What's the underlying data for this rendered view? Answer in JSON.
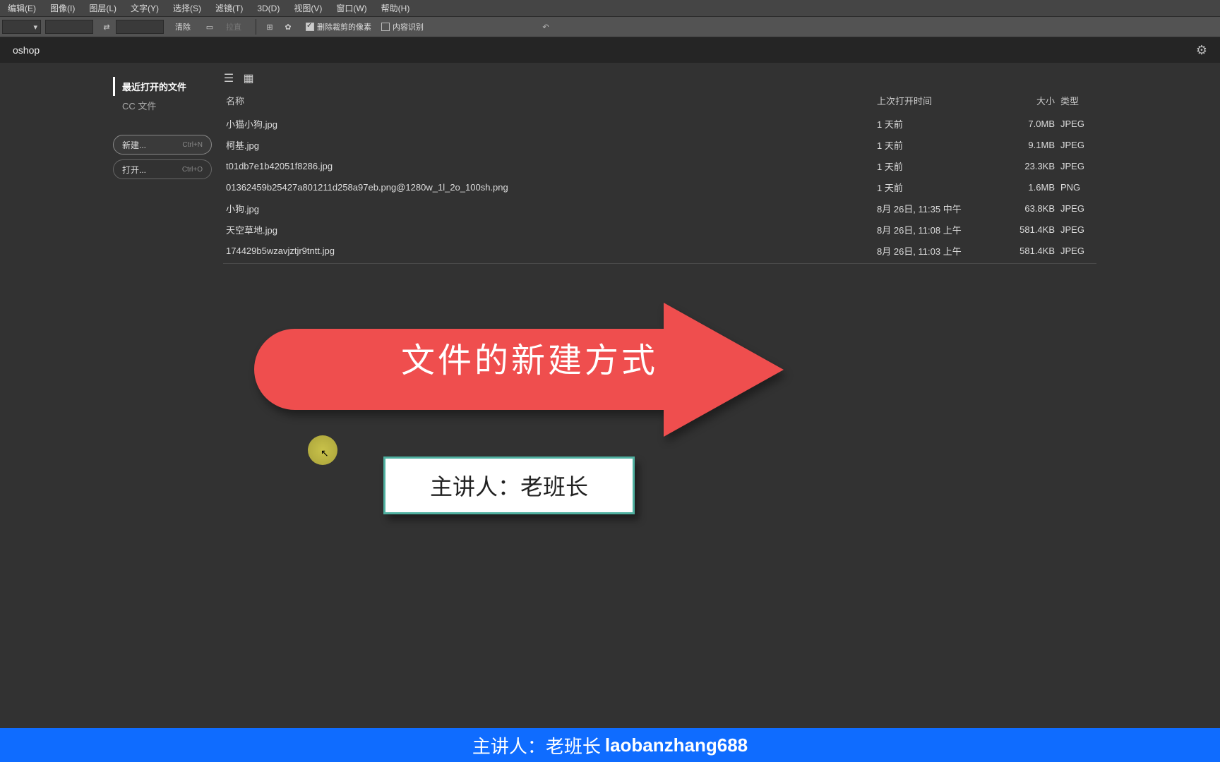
{
  "menubar": [
    "编辑(E)",
    "图像(I)",
    "图层(L)",
    "文字(Y)",
    "选择(S)",
    "滤镜(T)",
    "3D(D)",
    "视图(V)",
    "窗口(W)",
    "帮助(H)"
  ],
  "toolbar": {
    "clear": "清除",
    "straighten": "拉直",
    "opt1": "删除裁剪的像素",
    "opt2": "内容识别"
  },
  "appname": "oshop",
  "sidebar": {
    "recent": "最近打开的文件",
    "ccfiles": "CC 文件",
    "newbtn": "新建...",
    "newshort": "Ctrl+N",
    "openbtn": "打开...",
    "openshort": "Ctrl+O"
  },
  "cols": {
    "name": "名称",
    "opened": "上次打开时间",
    "size": "大小",
    "type": "类型"
  },
  "rows": [
    {
      "name": "小猫小狗.jpg",
      "opened": "1 天前",
      "size": "7.0MB",
      "type": "JPEG"
    },
    {
      "name": "柯基.jpg",
      "opened": "1 天前",
      "size": "9.1MB",
      "type": "JPEG"
    },
    {
      "name": "t01db7e1b42051f8286.jpg",
      "opened": "1 天前",
      "size": "23.3KB",
      "type": "JPEG"
    },
    {
      "name": "01362459b25427a801211d258a97eb.png@1280w_1l_2o_100sh.png",
      "opened": "1 天前",
      "size": "1.6MB",
      "type": "PNG"
    },
    {
      "name": "小狗.jpg",
      "opened": "8月 26日, 11:35 中午",
      "size": "63.8KB",
      "type": "JPEG"
    },
    {
      "name": "天空草地.jpg",
      "opened": "8月 26日, 11:08 上午",
      "size": "581.4KB",
      "type": "JPEG"
    },
    {
      "name": "174429b5wzavjztjr9tntt.jpg",
      "opened": "8月 26日, 11:03 上午",
      "size": "581.4KB",
      "type": "JPEG"
    }
  ],
  "arrow_text": "文件的新建方式",
  "speaker_box": "主讲人：老班长",
  "banner": {
    "label": "主讲人：老班长",
    "id": "laobanzhang688"
  }
}
